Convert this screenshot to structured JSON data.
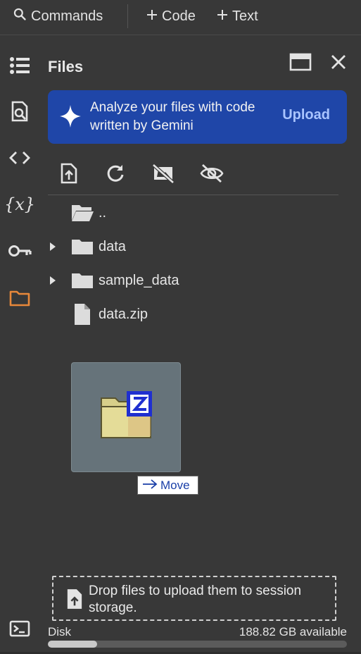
{
  "toolbar": {
    "commands_label": "Commands",
    "code_label": "Code",
    "text_label": "Text"
  },
  "rail": {
    "icons": [
      "toc-icon",
      "find-icon",
      "code-snippets-icon",
      "variables-icon",
      "secrets-key-icon",
      "files-folder-icon",
      "terminal-icon"
    ],
    "active": "files-folder-icon",
    "active_color": "#e8883a"
  },
  "panel": {
    "title": "Files"
  },
  "banner": {
    "text": "Analyze your files with code written by Gemini",
    "button_label": "Upload",
    "background": "#1f46a8"
  },
  "files": [
    {
      "name": "..",
      "type": "parent-folder",
      "expandable": false
    },
    {
      "name": "data",
      "type": "folder",
      "expandable": true
    },
    {
      "name": "sample_data",
      "type": "folder",
      "expandable": true
    },
    {
      "name": "data.zip",
      "type": "file",
      "expandable": false
    }
  ],
  "drag": {
    "tooltip": "Move"
  },
  "dropzone": {
    "text": "Drop files to upload them to session storage."
  },
  "disk": {
    "label": "Disk",
    "available": "188.82 GB available",
    "used_fraction": 0.165
  }
}
